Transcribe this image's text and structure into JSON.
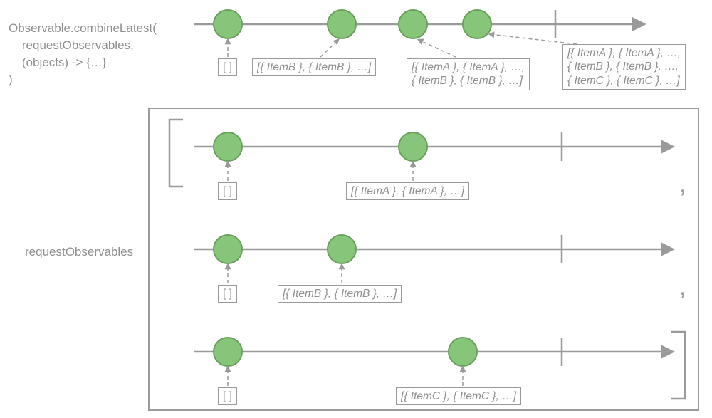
{
  "chart_data": {
    "type": "marble-diagram",
    "operator": "Observable.combineLatest",
    "result_timeline": {
      "events": [
        {
          "t": 320,
          "label": "[ ]"
        },
        {
          "t": 480,
          "label": "[{ ItemB }, { ItemB }, …]"
        },
        {
          "t": 580,
          "label": "[{ ItemA }, { ItemA }, …, { ItemB }, { ItemB }, …]"
        },
        {
          "t": 670,
          "label": "[{ ItemA }, { ItemA }, …, { ItemB }, { ItemB }, …, { ItemC }, { ItemC }, …]"
        }
      ],
      "complete_at": 780
    },
    "source_timelines": [
      {
        "events": [
          {
            "t": 320,
            "label": "[ ]"
          },
          {
            "t": 580,
            "label": "[{ ItemA }, { ItemA }, …]"
          }
        ],
        "complete_at": 780
      },
      {
        "events": [
          {
            "t": 320,
            "label": "[ ]"
          },
          {
            "t": 480,
            "label": "[{ ItemB }, { ItemB }, …]"
          }
        ],
        "complete_at": 780
      },
      {
        "events": [
          {
            "t": 320,
            "label": "[ ]"
          },
          {
            "t": 650,
            "label": "[{ ItemC }, { ItemC }, …]"
          }
        ],
        "complete_at": 780
      }
    ]
  },
  "labels": {
    "operator_line1": "Observable.combineLatest(",
    "operator_line2": "    requestObservables,",
    "operator_line3": "    (objects) -> {…}",
    "operator_line4": ")",
    "sources_label": "requestObservables"
  },
  "boxes": {
    "empty": "[ ]",
    "itemA": "[{ ItemA }, { ItemA }, …]",
    "itemB": "[{ ItemB }, { ItemB }, …]",
    "itemC": "[{ ItemC }, { ItemC }, …]",
    "resultAB_l1": "[{ ItemA }, { ItemA }, …,",
    "resultAB_l2": " { ItemB }, { ItemB }, …]",
    "resultABC_l1": "[{ ItemA }, { ItemA }, …,",
    "resultABC_l2": " { ItemB }, { ItemB }, …,",
    "resultABC_l3": " { ItemC }, { ItemC }, …]"
  }
}
